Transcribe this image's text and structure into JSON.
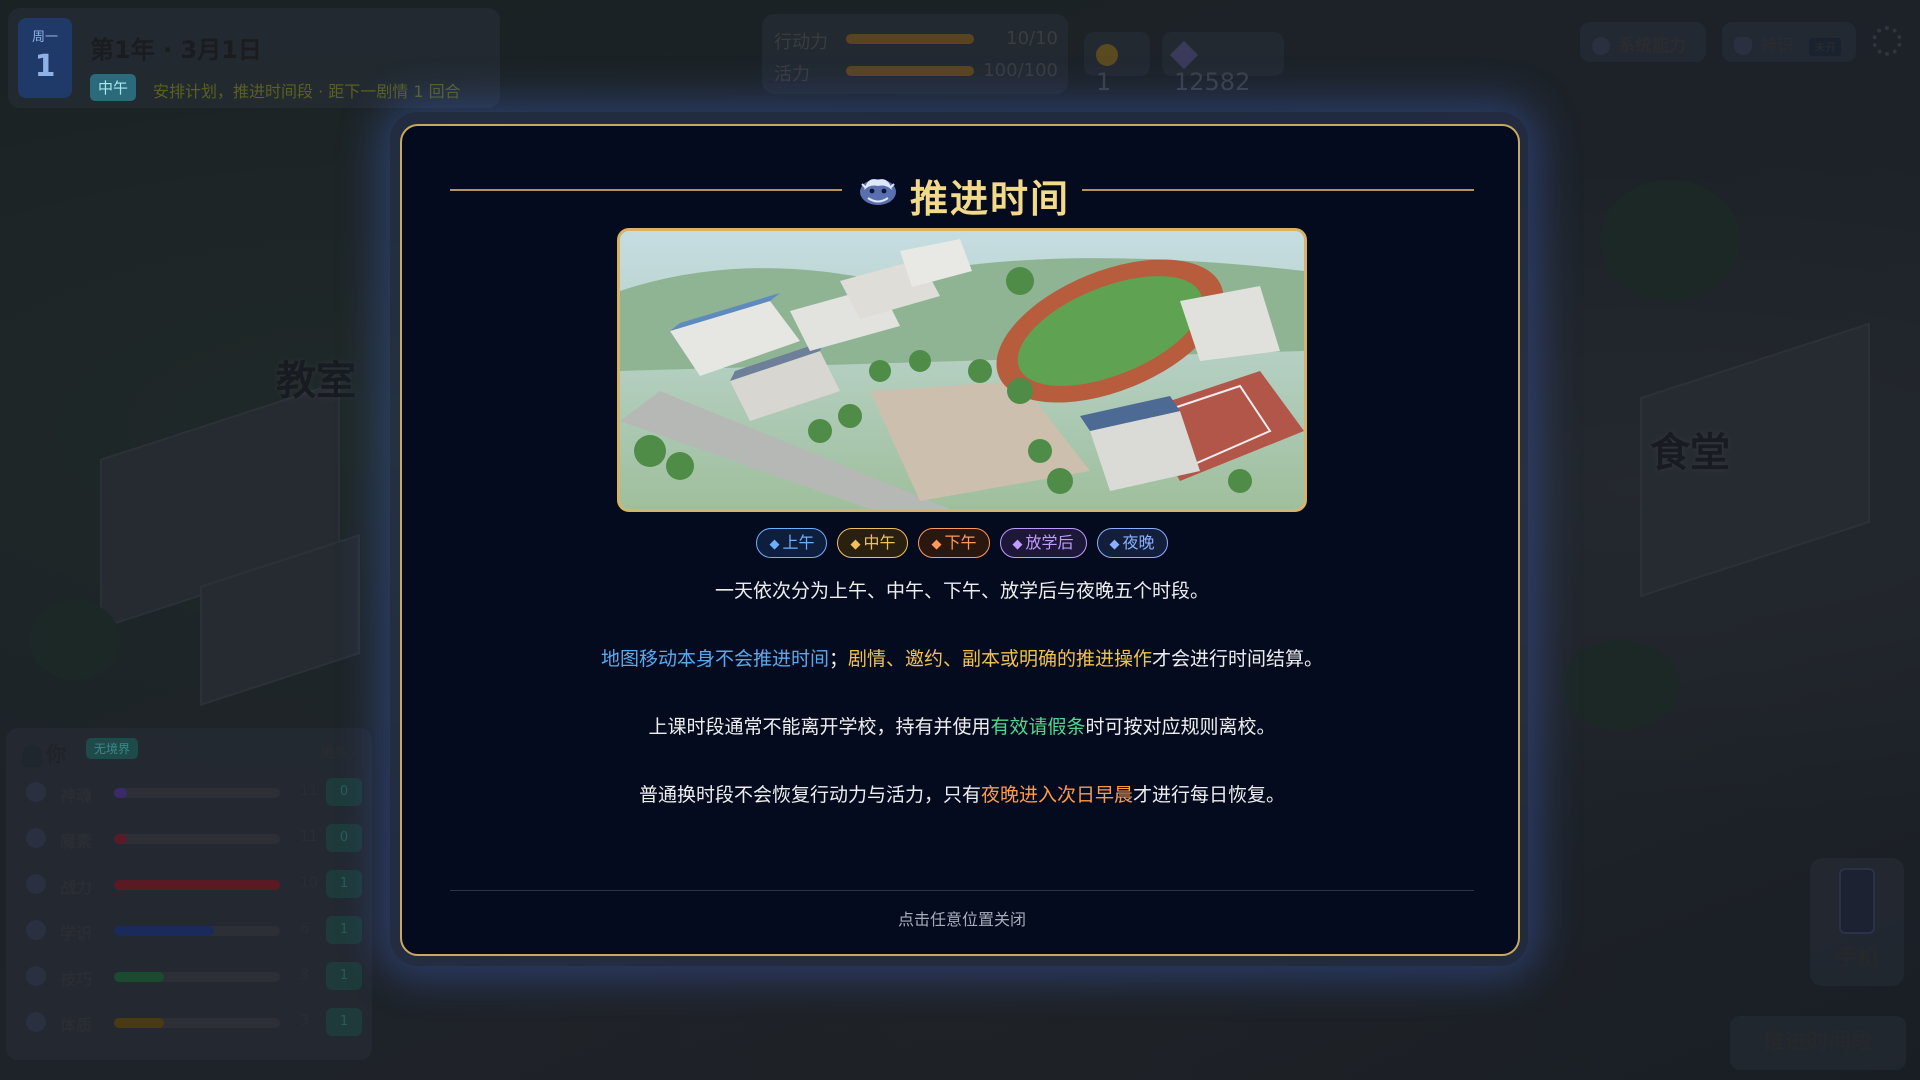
{
  "hud": {
    "week_label": "周一",
    "week_num": "1",
    "date": "第1年 · 3月1日",
    "period": "中午",
    "hint": "安排计划，推进时间段 · 距下一剧情 1 回合",
    "stats": [
      {
        "label": "行动力",
        "value": "10/10",
        "fraction": 1.0
      },
      {
        "label": "活力",
        "value": "100/100",
        "fraction": 1.0
      }
    ],
    "coins": "1",
    "gems": "12582",
    "system_ability": "系统能力",
    "divine_label": "神识",
    "divine_badge": "未开"
  },
  "map": {
    "labels": [
      "教室",
      "食堂"
    ]
  },
  "player": {
    "name": "你",
    "tag": "无境界",
    "more": "更多 ›",
    "attrs": [
      {
        "name": "神魂",
        "value": "11",
        "box": "0",
        "fraction": 0.08,
        "color": "#3a2a6a"
      },
      {
        "name": "魔素",
        "value": "11",
        "box": "0",
        "fraction": 0.08,
        "color": "#5a1a2a"
      },
      {
        "name": "战力",
        "value": "10",
        "box": "1",
        "fraction": 1.0,
        "color": "#5a1a24"
      },
      {
        "name": "学识",
        "value": "6",
        "box": "1",
        "fraction": 0.6,
        "color": "#1a2a5a"
      },
      {
        "name": "技巧",
        "value": "3",
        "box": "1",
        "fraction": 0.3,
        "color": "#1a4a30"
      },
      {
        "name": "体质",
        "value": "3",
        "box": "1",
        "fraction": 0.3,
        "color": "#4a3a14"
      }
    ]
  },
  "phone_label": "手机",
  "advance_button": "推进时间段",
  "modal": {
    "title": "推进时间",
    "periods": [
      {
        "label": "上午",
        "color": "#6ab0ff",
        "bg": "#0e1f3e"
      },
      {
        "label": "中午",
        "color": "#f0c060",
        "bg": "#2a2010"
      },
      {
        "label": "下午",
        "color": "#ff9a5a",
        "bg": "#2a1710"
      },
      {
        "label": "放学后",
        "color": "#c09aff",
        "bg": "#1e1838"
      },
      {
        "label": "夜晚",
        "color": "#8ab0ff",
        "bg": "#121e3a"
      }
    ],
    "line1": "一天依次分为上午、中午、下午、放学后与夜晚五个时段。",
    "line2": {
      "a": "地图移动本身不会推进时间",
      "b": "；",
      "c": "剧情、邀约、副本或明确的推进操作",
      "d": "才会进行时间结算。"
    },
    "line3": {
      "a": "上课时段通常不能离开学校，持有并使用",
      "b": "有效请假条",
      "c": "时可按对应规则离校。"
    },
    "line4": {
      "a": "普通换时段不会恢复行动力与活力，只有",
      "b": "夜晚进入次日早晨",
      "c": "才进行每日恢复。"
    },
    "close_hint": "点击任意位置关闭"
  }
}
